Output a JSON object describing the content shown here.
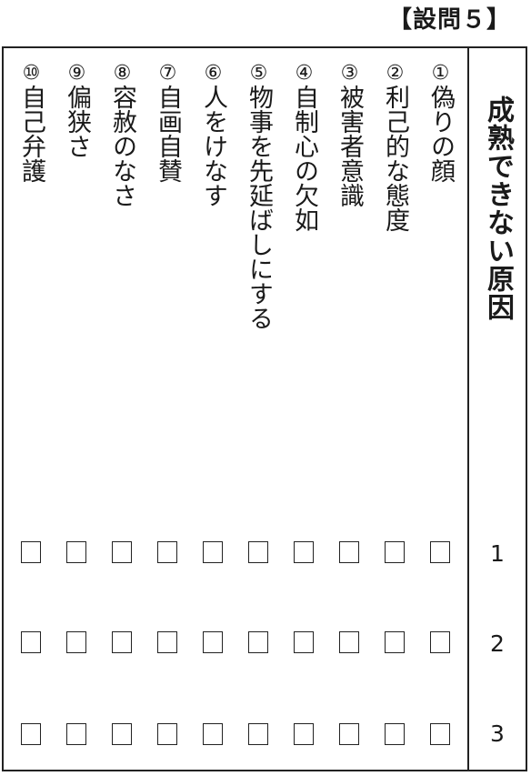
{
  "question_label": "【設問５】",
  "header": "成熟できない原因",
  "row_numbers": [
    "1",
    "2",
    "3"
  ],
  "items": [
    {
      "num": "①",
      "text": "偽りの顔"
    },
    {
      "num": "②",
      "text": "利己的な態度"
    },
    {
      "num": "③",
      "text": "被害者意識"
    },
    {
      "num": "④",
      "text": "自制心の欠如"
    },
    {
      "num": "⑤",
      "text": "物事を先延ばしにする"
    },
    {
      "num": "⑥",
      "text": "人をけなす"
    },
    {
      "num": "⑦",
      "text": "自画自賛"
    },
    {
      "num": "⑧",
      "text": "容赦のなさ"
    },
    {
      "num": "⑨",
      "text": "偏狭さ"
    },
    {
      "num": "⑩",
      "text": "自己弁護"
    }
  ],
  "checkbox_states": {
    "row_1": [
      false,
      false,
      false,
      false,
      false,
      false,
      false,
      false,
      false,
      false
    ],
    "row_2": [
      false,
      false,
      false,
      false,
      false,
      false,
      false,
      false,
      false,
      false
    ],
    "row_3": [
      false,
      false,
      false,
      false,
      false,
      false,
      false,
      false,
      false,
      false
    ]
  }
}
